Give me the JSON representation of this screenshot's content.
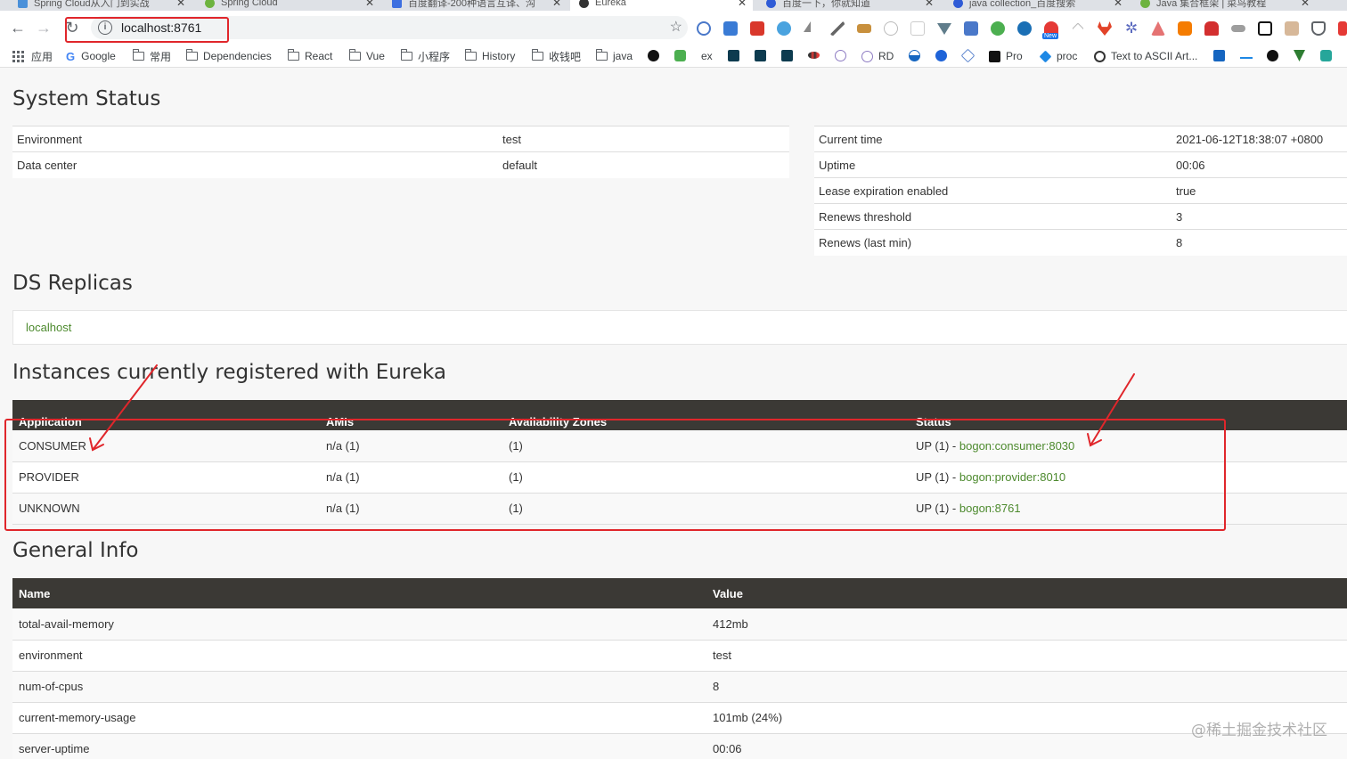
{
  "browser": {
    "tabs": [
      {
        "title": "Spring Cloud从入门到实战",
        "active": false
      },
      {
        "title": "Spring Cloud",
        "active": false
      },
      {
        "title": "百度翻译-200种语言互译、沟",
        "active": false
      },
      {
        "title": "Eureka",
        "active": true
      },
      {
        "title": "百度一下，你就知道",
        "active": false
      },
      {
        "title": "java collection_百度搜索",
        "active": false
      },
      {
        "title": "Java 集合框架 | 菜鸟教程",
        "active": false
      }
    ],
    "url": "localhost:8761",
    "extension_new_badge": "New",
    "bookmarks": [
      {
        "label": "应用",
        "icon": "apps-grid-icon"
      },
      {
        "label": "Google",
        "icon": "google-icon"
      },
      {
        "label": "常用",
        "icon": "folder-icon"
      },
      {
        "label": "Dependencies",
        "icon": "folder-icon"
      },
      {
        "label": "React",
        "icon": "folder-icon"
      },
      {
        "label": "Vue",
        "icon": "folder-icon"
      },
      {
        "label": "小程序",
        "icon": "folder-icon"
      },
      {
        "label": "History",
        "icon": "folder-icon"
      },
      {
        "label": "收钱吧",
        "icon": "folder-icon"
      },
      {
        "label": "java",
        "icon": "folder-icon"
      },
      {
        "label": "ex",
        "icon": "site-icon"
      },
      {
        "label": "RD",
        "icon": "site-icon"
      },
      {
        "label": "Pro",
        "icon": "site-icon"
      },
      {
        "label": "proc",
        "icon": "site-icon"
      },
      {
        "label": "Text to ASCII Art...",
        "icon": "site-icon"
      }
    ]
  },
  "system_status": {
    "title": "System Status",
    "left": [
      {
        "label": "Environment",
        "value": "test"
      },
      {
        "label": "Data center",
        "value": "default"
      }
    ],
    "right": [
      {
        "label": "Current time",
        "value": "2021-06-12T18:38:07 +0800"
      },
      {
        "label": "Uptime",
        "value": "00:06"
      },
      {
        "label": "Lease expiration enabled",
        "value": "true"
      },
      {
        "label": "Renews threshold",
        "value": "3"
      },
      {
        "label": "Renews (last min)",
        "value": "8"
      }
    ]
  },
  "replicas": {
    "title": "DS Replicas",
    "items": [
      "localhost"
    ]
  },
  "instances": {
    "title": "Instances currently registered with Eureka",
    "headers": [
      "Application",
      "AMIs",
      "Availability Zones",
      "Status"
    ],
    "rows": [
      {
        "application": "CONSUMER",
        "amis": "n/a (1)",
        "zones": "(1)",
        "status_prefix": "UP (1) - ",
        "status_link": "bogon:consumer:8030"
      },
      {
        "application": "PROVIDER",
        "amis": "n/a (1)",
        "zones": "(1)",
        "status_prefix": "UP (1) - ",
        "status_link": "bogon:provider:8010"
      },
      {
        "application": "UNKNOWN",
        "amis": "n/a (1)",
        "zones": "(1)",
        "status_prefix": "UP (1) - ",
        "status_link": "bogon:8761"
      }
    ]
  },
  "general_info": {
    "title": "General Info",
    "headers": [
      "Name",
      "Value"
    ],
    "rows": [
      {
        "name": "total-avail-memory",
        "value": "412mb"
      },
      {
        "name": "environment",
        "value": "test"
      },
      {
        "name": "num-of-cpus",
        "value": "8"
      },
      {
        "name": "current-memory-usage",
        "value": "101mb (24%)"
      },
      {
        "name": "server-uptime",
        "value": "00:06"
      }
    ]
  },
  "watermark": "@稀土掘金技术社区",
  "colors": {
    "annotation_red": "#e0262b",
    "link_green": "#4d8a2e",
    "table_header": "#3b3935"
  }
}
